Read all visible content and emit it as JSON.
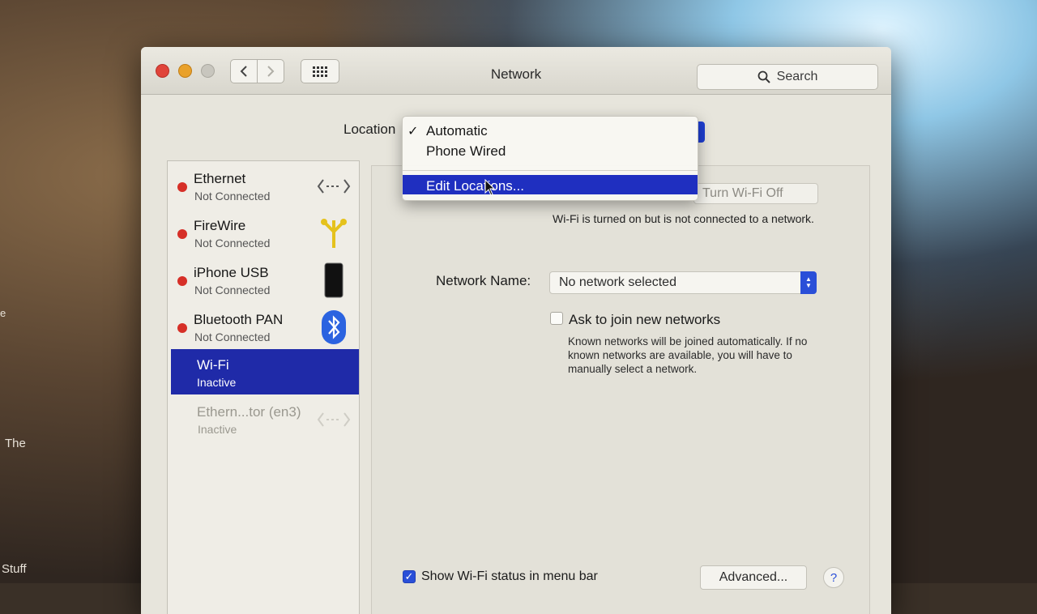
{
  "desktop": {
    "label_the": "The",
    "label_stuff": "Stuff",
    "label_e": "e"
  },
  "window": {
    "title": "Network",
    "search_placeholder": "Search",
    "back_icon": "chevron-left-icon",
    "forward_icon": "chevron-right-icon",
    "grid_icon": "show-all-grid-icon"
  },
  "location": {
    "label": "Location",
    "menu": {
      "items": [
        {
          "label": "Automatic",
          "checked": true
        },
        {
          "label": "Phone Wired",
          "checked": false
        },
        {
          "label": "Edit Locations...",
          "highlighted": true
        }
      ]
    }
  },
  "services": [
    {
      "name": "Ethernet",
      "status": "Not Connected",
      "dot": "#d62f27",
      "icon": "ethernet-arrows-icon"
    },
    {
      "name": "FireWire",
      "status": "Not Connected",
      "dot": "#d62f27",
      "icon": "firewire-icon"
    },
    {
      "name": "iPhone USB",
      "status": "Not Connected",
      "dot": "#d62f27",
      "icon": "iphone-icon"
    },
    {
      "name": "Bluetooth PAN",
      "status": "Not Connected",
      "dot": "#d62f27",
      "icon": "bluetooth-icon"
    },
    {
      "name": "Wi-Fi",
      "status": "Inactive",
      "selected": true
    },
    {
      "name": "Ethern...tor (en3)",
      "status": "Inactive",
      "icon": "ethernet-arrows-icon"
    }
  ],
  "wifi": {
    "turn_off_label": "Turn Wi-Fi Off",
    "status_text": "Wi-Fi is turned on but is not connected to a network.",
    "network_name_label": "Network Name:",
    "network_name_value": "No network selected",
    "ask_join_label": "Ask to join new networks",
    "ask_join_checked": false,
    "ask_join_help": "Known networks will be joined automatically. If no known networks are available, you will have to manually select a network.",
    "show_status_label": "Show Wi-Fi status in menu bar",
    "show_status_checked": true,
    "advanced_label": "Advanced...",
    "help_label": "?"
  },
  "colors": {
    "selection": "#1f2aa8",
    "accent": "#2a4fd8",
    "status_red": "#d62f27"
  }
}
